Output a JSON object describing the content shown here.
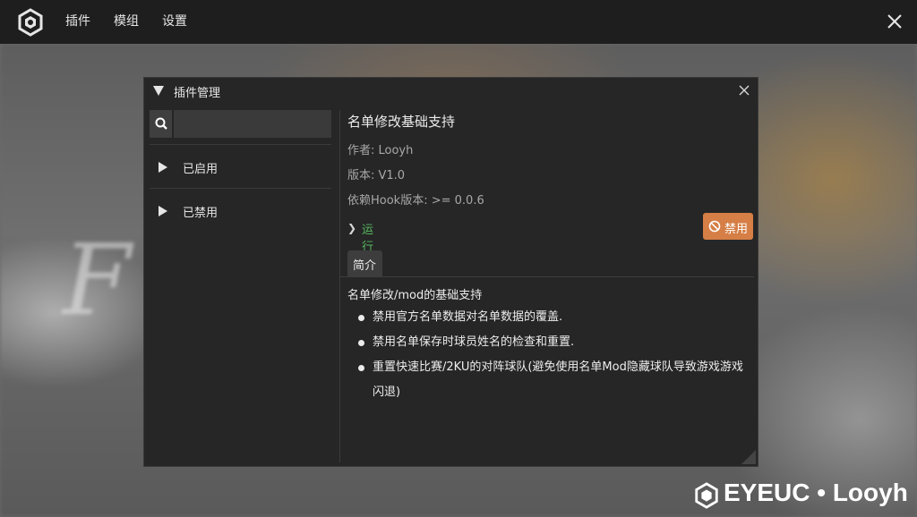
{
  "topbar": {
    "menu": [
      "插件",
      "模组",
      "设置"
    ]
  },
  "panel": {
    "title": "插件管理",
    "search_placeholder": "",
    "groups": [
      "已启用",
      "已禁用"
    ]
  },
  "plugin": {
    "name": "名单修改基础支持",
    "author": "作者:  Looyh",
    "version": "版本:  V1.0",
    "dependency": "依赖Hook版本:  >= 0.0.6",
    "status": "运行中",
    "disable_label": "禁用",
    "tab": "简介",
    "desc_title": "名单修改/mod的基础支持",
    "bullets": [
      "禁用官方名单数据对名单数据的覆盖.",
      "禁用名单保存时球员姓名的检查和重置.",
      "重置快速比赛/2KU的对阵球队(避免使用名单Mod隐藏球队导致游戏游戏闪退)"
    ]
  },
  "watermark": "EYEUC • Looyh",
  "colors": {
    "topbar": "#1e1e1e",
    "panel": "#262626",
    "status_green": "#55b860",
    "disable_button": "#d57e45"
  }
}
